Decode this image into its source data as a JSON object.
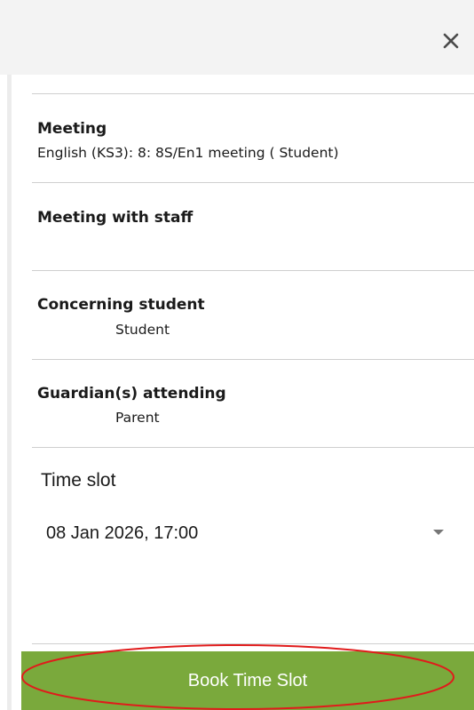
{
  "header": {
    "close_icon": "close-icon"
  },
  "details": {
    "meeting": {
      "label": "Meeting",
      "value": "English (KS3): 8: 8S/En1 meeting ( Student)"
    },
    "staff": {
      "label": "Meeting with staff",
      "value": ""
    },
    "student": {
      "label": "Concerning student",
      "value": "Student"
    },
    "guardians": {
      "label": "Guardian(s) attending",
      "value": "Parent"
    }
  },
  "time_slot": {
    "label": "Time slot",
    "selected": "08 Jan 2026, 17:00",
    "arrow_icon": "caret-down-icon"
  },
  "actions": {
    "book_label": "Book Time Slot"
  },
  "colors": {
    "header_bg": "#f3f3f3",
    "divider": "#cfcfcf",
    "primary_button": "#7aa93c",
    "button_text": "#ffffff",
    "annotation": "#e01b1b"
  }
}
